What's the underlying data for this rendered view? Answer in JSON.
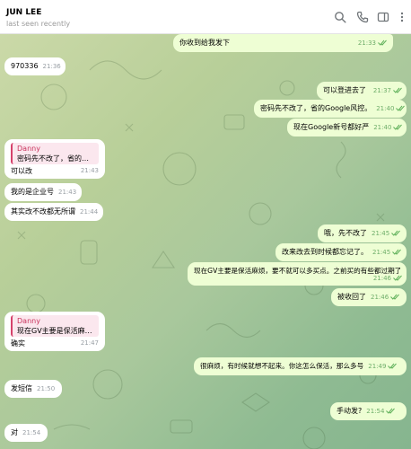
{
  "header": {
    "name": "JUN LEE",
    "status": "last seen recently"
  },
  "icons": [
    "search-icon",
    "phone-icon",
    "sidebar-icon",
    "more-icon"
  ],
  "messages": [
    {
      "text": "你收到给我发下",
      "time": "21:33"
    },
    {
      "text": "970336",
      "time": "21:36"
    },
    {
      "text": "可以登进去了",
      "time": "21:37"
    },
    {
      "text": "密码先不改了，省的Google风控。",
      "time": "21:40"
    },
    {
      "text": "现在Google新号都好严",
      "time": "21:40"
    },
    {
      "reply_name": "Danny",
      "reply_text": "密码先不改了，省的Go...",
      "text": "可以改",
      "time": "21:43"
    },
    {
      "text": "我的是企业号",
      "time": "21:43"
    },
    {
      "text": "其实改不改都无所谓",
      "time": "21:44"
    },
    {
      "text": "哦，先不改了",
      "time": "21:45"
    },
    {
      "text": "改来改去到时候都忘记了。",
      "time": "21:45"
    },
    {
      "text": "现在GV主要是保活麻烦，要不就可以多买点。之前买的有些都过期了",
      "time": "21:46"
    },
    {
      "text": "被收回了",
      "time": "21:46"
    },
    {
      "reply_name": "Danny",
      "reply_text": "现在GV主要是保活麻烦...",
      "text": "确实",
      "time": "21:47"
    },
    {
      "text": "很麻烦，有时候就想不起来。你这怎么保活，那么多号",
      "time": "21:49"
    },
    {
      "text": "发短信",
      "time": "21:50"
    },
    {
      "text": "手动发?",
      "time": "21:54"
    },
    {
      "text": "对",
      "time": "21:54"
    }
  ],
  "colors": {
    "incoming": "#ffffff",
    "outgoing": "#eefed4",
    "reply_accent": "#d6426b",
    "tick": "#5fb05a"
  }
}
